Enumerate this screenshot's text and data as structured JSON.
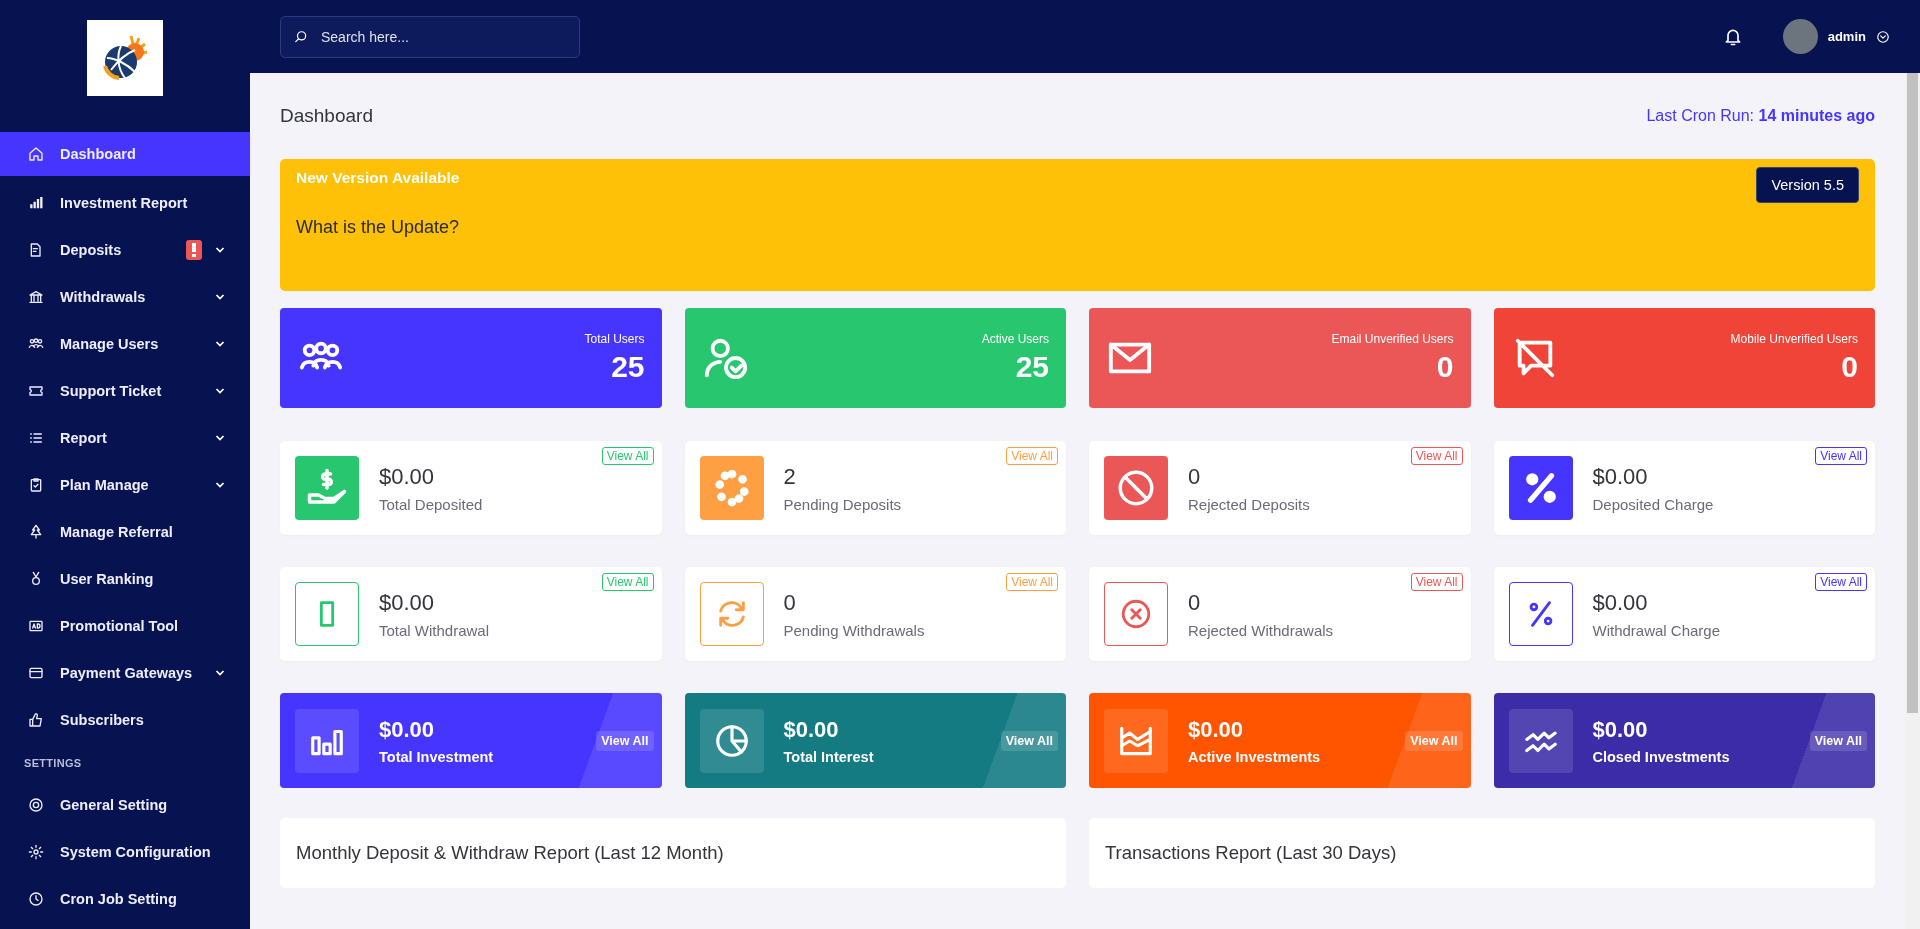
{
  "sidebar": {
    "items": [
      {
        "label": "Dashboard",
        "selected": true,
        "has_submenu": false,
        "alert": false
      },
      {
        "label": "Investment Report",
        "selected": false,
        "has_submenu": false,
        "alert": false
      },
      {
        "label": "Deposits",
        "selected": false,
        "has_submenu": true,
        "alert": true
      },
      {
        "label": "Withdrawals",
        "selected": false,
        "has_submenu": true,
        "alert": false
      },
      {
        "label": "Manage Users",
        "selected": false,
        "has_submenu": true,
        "alert": false
      },
      {
        "label": "Support Ticket",
        "selected": false,
        "has_submenu": true,
        "alert": false
      },
      {
        "label": "Report",
        "selected": false,
        "has_submenu": true,
        "alert": false
      },
      {
        "label": "Plan Manage",
        "selected": false,
        "has_submenu": true,
        "alert": false
      },
      {
        "label": "Manage Referral",
        "selected": false,
        "has_submenu": false,
        "alert": false
      },
      {
        "label": "User Ranking",
        "selected": false,
        "has_submenu": false,
        "alert": false
      },
      {
        "label": "Promotional Tool",
        "selected": false,
        "has_submenu": false,
        "alert": false
      },
      {
        "label": "Payment Gateways",
        "selected": false,
        "has_submenu": true,
        "alert": false
      },
      {
        "label": "Subscribers",
        "selected": false,
        "has_submenu": false,
        "alert": false
      }
    ],
    "section_title": "SETTINGS",
    "settings_items": [
      {
        "label": "General Setting",
        "selected": false,
        "has_submenu": false,
        "alert": false
      },
      {
        "label": "System Configuration",
        "selected": false,
        "has_submenu": false,
        "alert": false
      },
      {
        "label": "Cron Job Setting",
        "selected": false,
        "has_submenu": false,
        "alert": false
      }
    ]
  },
  "topbar": {
    "search": {
      "placeholder": "Search here..."
    },
    "user": "admin"
  },
  "header": {
    "title": "Dashboard",
    "cron_label": "Last Cron Run:",
    "cron_value": "14 minutes ago"
  },
  "banner": {
    "title": "New Version Available",
    "question": "What is the Update?",
    "version": "Version 5.5"
  },
  "stats": [
    {
      "label": "Total Users",
      "value": "25",
      "color": "#4634ff"
    },
    {
      "label": "Active Users",
      "value": "25",
      "color": "#28c76f"
    },
    {
      "label": "Email Unverified Users",
      "value": "0",
      "color": "#eb5757"
    },
    {
      "label": "Mobile Unverified Users",
      "value": "0",
      "color": "#f04438"
    }
  ],
  "widgets": [
    {
      "kind": "filled",
      "value": "$0.00",
      "label": "Total Deposited",
      "link": "View All",
      "color": "#28c76f"
    },
    {
      "kind": "filled",
      "value": "2",
      "label": "Pending Deposits",
      "link": "View All",
      "color": "#ff9f43"
    },
    {
      "kind": "filled",
      "value": "0",
      "label": "Rejected Deposits",
      "link": "View All",
      "color": "#eb5757"
    },
    {
      "kind": "filled",
      "value": "$0.00",
      "label": "Deposited Charge",
      "link": "View All",
      "color": "#4634ff"
    },
    {
      "kind": "outline",
      "value": "$0.00",
      "label": "Total Withdrawal",
      "link": "View All",
      "color": "#28c76f"
    },
    {
      "kind": "outline",
      "value": "0",
      "label": "Pending Withdrawals",
      "link": "View All",
      "color": "#ff9f43"
    },
    {
      "kind": "outline",
      "value": "0",
      "label": "Rejected Withdrawals",
      "link": "View All",
      "color": "#eb5757"
    },
    {
      "kind": "outline",
      "value": "$0.00",
      "label": "Withdrawal Charge",
      "link": "View All",
      "color": "#4634ff"
    }
  ],
  "investments": [
    {
      "value": "$0.00",
      "label": "Total Investment",
      "link": "View All",
      "color": "#4634ff"
    },
    {
      "value": "$0.00",
      "label": "Total Interest",
      "link": "View All",
      "color": "#147b83"
    },
    {
      "value": "$0.00",
      "label": "Active Investments",
      "link": "View All",
      "color": "#ff5400"
    },
    {
      "value": "$0.00",
      "label": "Closed Investments",
      "link": "View All",
      "color": "#3c2ca8"
    }
  ],
  "reports": [
    {
      "title": "Monthly Deposit & Withdraw Report (Last 12 Month)"
    },
    {
      "title": "Transactions Report (Last 30 Days)"
    }
  ]
}
